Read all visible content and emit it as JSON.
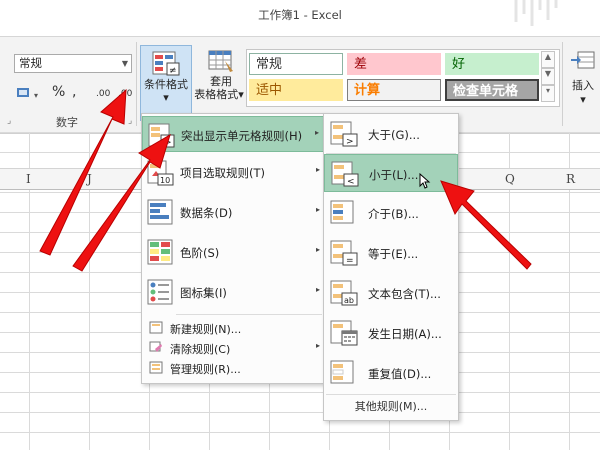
{
  "window": {
    "title": "工作簿1 - Excel"
  },
  "ribbon": {
    "number_format": {
      "value": "常规"
    },
    "number_buttons": {
      "currency": "%",
      "comma": ",",
      "inc_decimal": ".00",
      "dec_decimal": ".00"
    },
    "number_group_label": "数字",
    "conditional_format": {
      "label": "条件格式",
      "arrow": "▾"
    },
    "format_as_table": {
      "label_line1": "套用",
      "label_line2": "表格格式",
      "arrow": "▾"
    },
    "cell_styles": [
      {
        "label": "常规",
        "bg": "#ffffff",
        "border": "#8db3a2",
        "color": "#333333"
      },
      {
        "label": "差",
        "bg": "#ffc7ce",
        "border": "#ffc7ce",
        "color": "#9c0006"
      },
      {
        "label": "好",
        "bg": "#c6efce",
        "border": "#c6efce",
        "color": "#006100"
      },
      {
        "label": "适中",
        "bg": "#ffeb9c",
        "border": "#ffeb9c",
        "color": "#9c5700"
      },
      {
        "label": "计算",
        "bg": "#f2f2f2",
        "border": "#7f7f7f",
        "color": "#fa7d00"
      },
      {
        "label": "检查单元格",
        "bg": "#a5a5a5",
        "border": "#3f3f3f",
        "color": "#ffffff"
      }
    ],
    "insert": {
      "label": "插入",
      "arrow": "▾"
    }
  },
  "columns": [
    "I",
    "J",
    "Q",
    "R"
  ],
  "menu": {
    "items": [
      {
        "label": "突出显示单元格规则(H)",
        "icon": "highlight-rules-icon",
        "arrow": "▸"
      },
      {
        "label": "项目选取规则(T)",
        "icon": "top-bottom-rules-icon",
        "icon_text": "10",
        "arrow": "▸"
      },
      {
        "label": "数据条(D)",
        "icon": "data-bars-icon",
        "arrow": "▸"
      },
      {
        "label": "色阶(S)",
        "icon": "color-scales-icon",
        "arrow": "▸"
      },
      {
        "label": "图标集(I)",
        "icon": "icon-sets-icon",
        "arrow": "▸"
      }
    ],
    "small_items": [
      {
        "label": "新建规则(N)...",
        "icon": "new-rule-icon"
      },
      {
        "label": "清除规则(C)",
        "icon": "clear-rules-icon",
        "arrow": "▸"
      },
      {
        "label": "管理规则(R)...",
        "icon": "manage-rules-icon"
      }
    ]
  },
  "submenu": {
    "items": [
      {
        "label": "大于(G)...",
        "icon": "greater-than-icon",
        "sym": ">"
      },
      {
        "label": "小于(L)...",
        "icon": "less-than-icon",
        "sym": "<"
      },
      {
        "label": "介于(B)...",
        "icon": "between-icon"
      },
      {
        "label": "等于(E)...",
        "icon": "equal-to-icon",
        "sym": "="
      },
      {
        "label": "文本包含(T)...",
        "icon": "text-contains-icon",
        "sym": "ab"
      },
      {
        "label": "发生日期(A)...",
        "icon": "date-occurring-icon"
      },
      {
        "label": "重复值(D)...",
        "icon": "duplicate-values-icon"
      }
    ],
    "other": "其他规则(M)..."
  },
  "accent": {
    "selected_bg": "#a3d2b9",
    "arrow_red": "#ee1111"
  }
}
